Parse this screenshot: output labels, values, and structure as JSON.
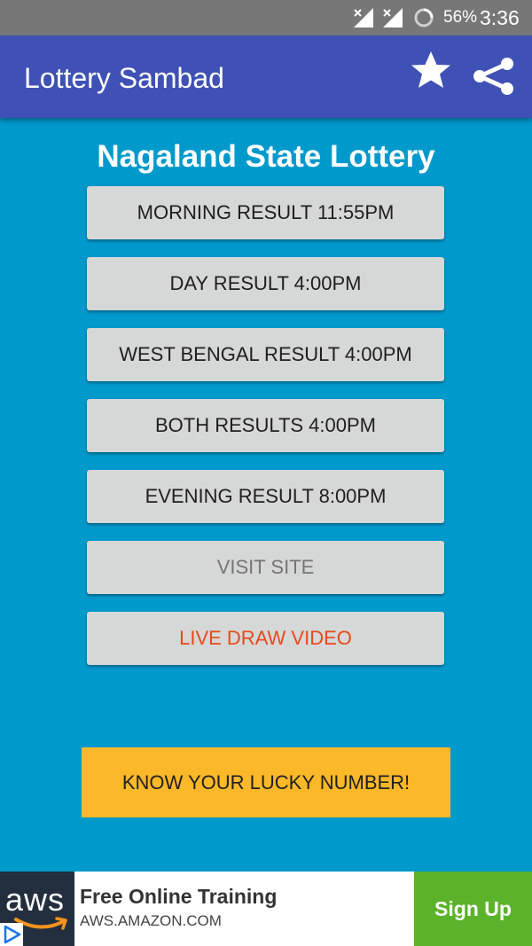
{
  "status_bar": {
    "battery": "56%",
    "time": "3:36"
  },
  "app_bar": {
    "title": "Lottery Sambad",
    "star_icon": "star-icon",
    "share_icon": "share-icon"
  },
  "main": {
    "heading": "Nagaland State Lottery",
    "buttons": [
      {
        "label": "MORNING RESULT 11:55PM"
      },
      {
        "label": "DAY RESULT 4:00PM"
      },
      {
        "label": "WEST BENGAL RESULT 4:00PM"
      },
      {
        "label": "BOTH RESULTS 4:00PM"
      },
      {
        "label": "EVENING RESULT 8:00PM"
      },
      {
        "label": "VISIT SITE"
      },
      {
        "label": "LIVE DRAW VIDEO"
      }
    ],
    "lucky_button": "KNOW YOUR LUCKY NUMBER!"
  },
  "ad": {
    "logo_text": "aws",
    "title": "Free Online Training",
    "url": "AWS.AMAZON.COM",
    "cta": "Sign Up"
  },
  "colors": {
    "background": "#0099cc",
    "app_bar": "#3f51b5",
    "status_bar": "#777777",
    "button": "#d6d7d7",
    "live_draw_text": "#e64a19",
    "lucky_button": "#fbb829",
    "ad_cta": "#5cb32b",
    "ad_logo_bg": "#232f3e"
  }
}
